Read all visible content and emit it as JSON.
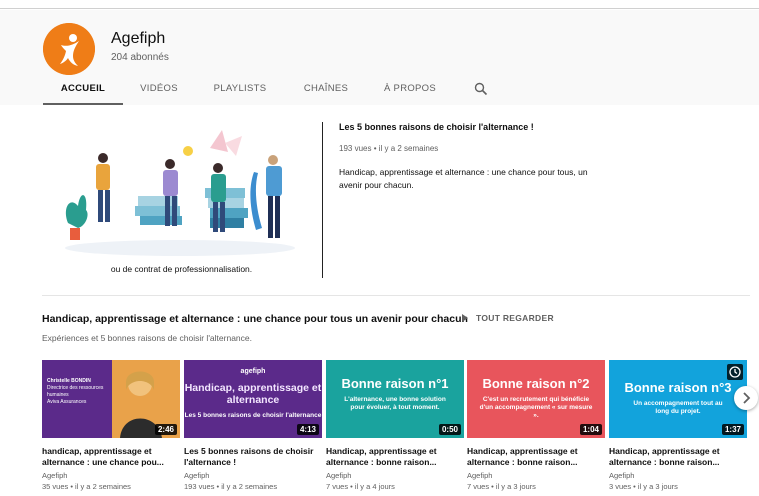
{
  "channel": {
    "name": "Agefiph",
    "subscribers": "204 abonnés",
    "brand_color": "#ef7d17"
  },
  "tabs": [
    {
      "label": "ACCUEIL",
      "active": true
    },
    {
      "label": "VIDÉOS",
      "active": false
    },
    {
      "label": "PLAYLISTS",
      "active": false
    },
    {
      "label": "CHAÎNES",
      "active": false
    },
    {
      "label": "À PROPOS",
      "active": false
    }
  ],
  "search_icon": "search-icon",
  "featured": {
    "caption": "ou de contrat de professionnalisation.",
    "title": "Les 5 bonnes raisons de choisir l'alternance !",
    "meta": "193 vues • il y a 2 semaines",
    "description": "Handicap, apprentissage et alternance : une chance pour tous, un avenir pour chacun."
  },
  "shelf": {
    "title": "Handicap, apprentissage et alternance : une chance pour tous un avenir pour chacun",
    "play_all": "TOUT REGARDER",
    "subtitle": "Expériences et 5 bonnes raisons de choisir l'alternance.",
    "videos": [
      {
        "title": "handicap, apprentissage et alternance : une chance pou...",
        "channel": "Agefiph",
        "meta": "35 vues • il y a 2 semaines",
        "duration": "2:46",
        "thumb_lines": [
          "Christelle BONDIN",
          "Directrice des ressources humaines",
          "Aviva Assurances"
        ]
      },
      {
        "title": "Les 5 bonnes raisons de choisir l'alternance !",
        "channel": "Agefiph",
        "meta": "193 vues • il y a 2 semaines",
        "duration": "4:13",
        "thumb_brand": "agefiph",
        "thumb_big": "Handicap, apprentissage et alternance",
        "thumb_small": "Les 5 bonnes raisons de choisir l'alternance"
      },
      {
        "title": "Handicap, apprentissage et alternance : bonne raison...",
        "channel": "Agefiph",
        "meta": "7 vues • il y a 4 jours",
        "duration": "0:50",
        "thumb_big": "Bonne raison n°1",
        "thumb_small": "L'alternance, une bonne solution pour évoluer, à tout moment."
      },
      {
        "title": "Handicap, apprentissage et alternance : bonne raison...",
        "channel": "Agefiph",
        "meta": "7 vues • il y a 3 jours",
        "duration": "1:04",
        "thumb_big": "Bonne raison n°2",
        "thumb_small": "C'est un recrutement qui bénéficie d'un accompagnement « sur mesure »."
      },
      {
        "title": "Handicap, apprentissage et alternance : bonne raison...",
        "channel": "Agefiph",
        "meta": "3 vues • il y a 3 jours",
        "duration": "1:37",
        "thumb_big": "Bonne raison n°3",
        "thumb_small": "Un accompagnement tout au long du projet."
      }
    ]
  },
  "colors": {
    "purple": "#5b2a8a",
    "teal": "#1aa39e",
    "red": "#e8555c",
    "blue": "#12a3dc"
  }
}
